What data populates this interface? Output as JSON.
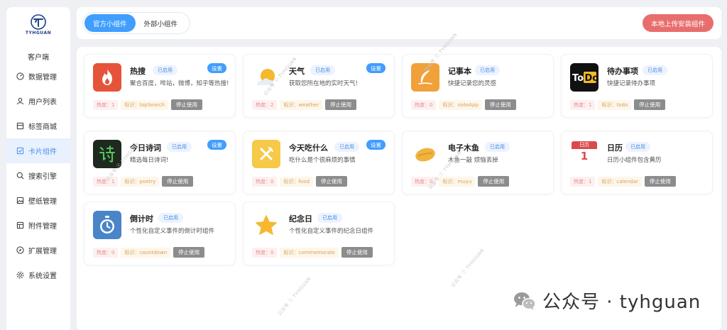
{
  "sidebar": {
    "logo_text": "TYHGUAN",
    "client_label": "客户端",
    "items": [
      {
        "label": "数据管理",
        "icon": "dashboard-icon"
      },
      {
        "label": "用户列表",
        "icon": "user-icon"
      },
      {
        "label": "标签商城",
        "icon": "tag-icon"
      },
      {
        "label": "卡片组件",
        "icon": "card-icon"
      },
      {
        "label": "搜索引擎",
        "icon": "search-icon"
      },
      {
        "label": "壁纸管理",
        "icon": "image-icon"
      },
      {
        "label": "附件管理",
        "icon": "attachment-icon"
      },
      {
        "label": "扩展管理",
        "icon": "compass-icon"
      },
      {
        "label": "系统设置",
        "icon": "gear-icon"
      }
    ],
    "active_index": 3
  },
  "topbar": {
    "tabs": [
      {
        "label": "官方小组件"
      },
      {
        "label": "外部小组件"
      }
    ],
    "upload_label": "本地上传安装组件"
  },
  "labels": {
    "status": "已启用",
    "settings": "设置",
    "heat_prefix": "热度：",
    "id_prefix": "标识：",
    "stop": "停止使用"
  },
  "cards": [
    {
      "title": "热搜",
      "desc": "聚合百度，哔站，微博，知乎等热搜!",
      "heat": "1",
      "id": "topSearch",
      "settings": true,
      "icon": "flame-icon",
      "color": "#e5543a"
    },
    {
      "title": "天气",
      "desc": "获取您所在地的实时天气!",
      "heat": "2",
      "id": "weather",
      "settings": true,
      "icon": "sun-cloud-icon",
      "color": "#ffffff"
    },
    {
      "title": "记事本",
      "desc": "快捷记录您的灵感",
      "heat": "0",
      "id": "noteApp",
      "settings": false,
      "icon": "feather-icon",
      "color": "#f0a13a"
    },
    {
      "title": "待办事项",
      "desc": "快捷记录待办事项",
      "heat": "1",
      "id": "todo",
      "settings": false,
      "icon": "todo-icon",
      "color": "#111111"
    },
    {
      "title": "今日诗词",
      "desc": "精选每日诗词!",
      "heat": "1",
      "id": "poetry",
      "settings": true,
      "icon": "poetry-icon",
      "color": "#1f2a1f"
    },
    {
      "title": "今天吃什么",
      "desc": "吃什么是个很麻烦的事情",
      "heat": "0",
      "id": "food",
      "settings": true,
      "icon": "fork-knife-icon",
      "color": "#f7c948"
    },
    {
      "title": "电子木鱼",
      "desc": "木鱼一敲 烦恼丢掉",
      "heat": "0",
      "id": "muyu",
      "settings": false,
      "icon": "wooden-fish-icon",
      "color": "#ffffff"
    },
    {
      "title": "日历",
      "desc": "日历小组件包含黄历",
      "heat": "1",
      "id": "calendar",
      "settings": false,
      "icon": "calendar-icon",
      "color": "#ffffff",
      "icon_text_top": "日历",
      "icon_text_num": "1"
    },
    {
      "title": "倒计时",
      "desc": "个性化自定义事件的倒计时组件",
      "heat": "0",
      "id": "countdown",
      "settings": false,
      "icon": "stopwatch-icon",
      "color": "#4a84c9"
    },
    {
      "title": "纪念日",
      "desc": "个性化自定义事件的纪念日组件",
      "heat": "0",
      "id": "commemorate",
      "settings": false,
      "icon": "star-icon",
      "color": "#ffffff"
    }
  ],
  "watermarks": {
    "mp": "公众号",
    "mp_name": "TYHGUAN"
  },
  "footer_watermark": "公众号 · tyhguan",
  "colors": {
    "accent": "#409eff",
    "upload": "#e86e6e",
    "stop": "#8c8c8c"
  }
}
